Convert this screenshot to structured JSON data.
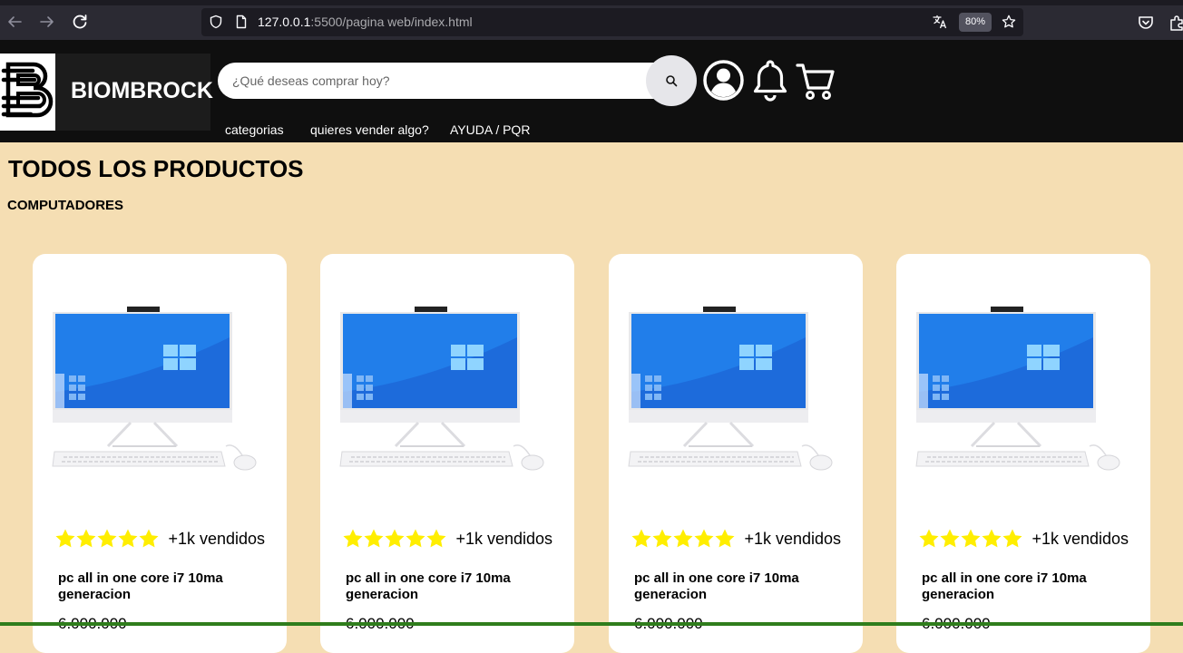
{
  "browser": {
    "url_host": "127.0.0.1",
    "url_path": ":5500/pagina web/index.html",
    "zoom": "80%"
  },
  "site": {
    "logo_text": "BIOMBROCK",
    "search_placeholder": "¿Qué deseas comprar hoy?",
    "menu": [
      "categorias",
      "quieres vender algo?",
      "AYUDA / PQR"
    ]
  },
  "page": {
    "title": "TODOS LOS PRODUCTOS",
    "section": "COMPUTADORES"
  },
  "products": [
    {
      "rating": 5,
      "sold": "+1k vendidos",
      "name": "pc all in one core i7 10ma generacion",
      "price": "6.000.000"
    },
    {
      "rating": 5,
      "sold": "+1k vendidos",
      "name": "pc all in one core i7 10ma generacion",
      "price": "6.000.000"
    },
    {
      "rating": 5,
      "sold": "+1k vendidos",
      "name": "pc all in one core i7 10ma generacion",
      "price": "6.000.000"
    },
    {
      "rating": 5,
      "sold": "+1k vendidos",
      "name": "pc all in one core i7 10ma generacion",
      "price": "6.000.000"
    }
  ],
  "colors": {
    "page_bg": "#f5deb3",
    "header_bg": "#0f0f0f",
    "star": "#ffee00",
    "screen_blue": "#1f7be8"
  },
  "icons": [
    "back-icon",
    "forward-icon",
    "reload-icon",
    "shield-icon",
    "page-icon",
    "translate-icon",
    "bookmark-star-icon",
    "pocket-icon",
    "extensions-icon",
    "search-icon",
    "user-icon",
    "bell-icon",
    "cart-icon",
    "star-icon"
  ]
}
